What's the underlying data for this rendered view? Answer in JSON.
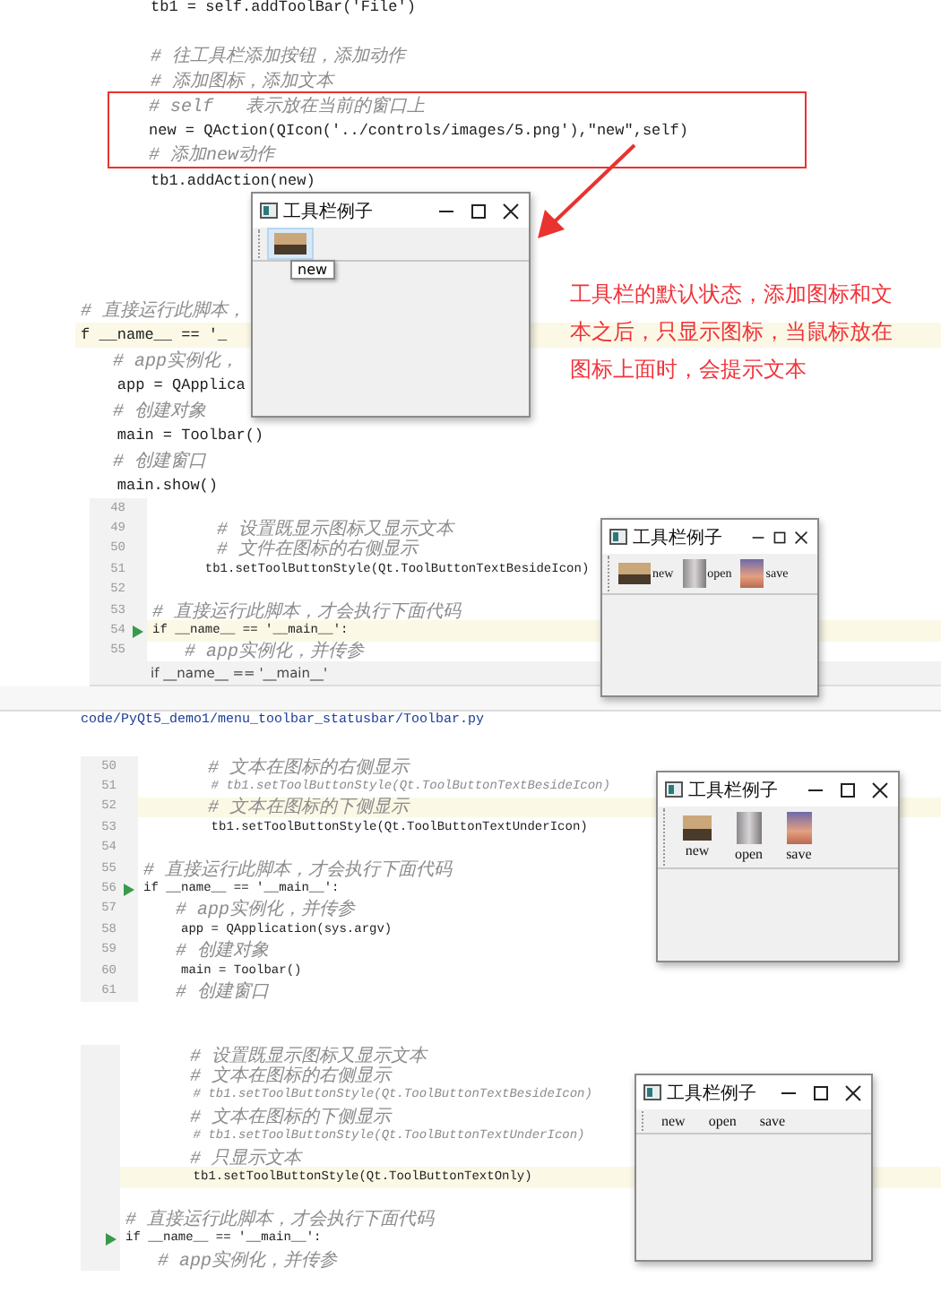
{
  "sections": [
    {
      "code_lines": [
        {
          "kind": "code",
          "text": "tb1 = self.addToolBar('File')",
          "boxed": false,
          "highlighted": false
        },
        {
          "kind": "blank",
          "boxed": false,
          "highlighted": false
        },
        {
          "kind": "comment",
          "text": "# 往工具栏添加按钮，添加动作",
          "boxed": false,
          "highlighted": false
        },
        {
          "kind": "comment",
          "text": "# 添加图标，添加文本",
          "boxed": false,
          "highlighted": false
        },
        {
          "kind": "comment",
          "text": "# self   表示放在当前的窗口上",
          "boxed": true,
          "highlighted": false
        },
        {
          "kind": "code",
          "text": "new = QAction(QIcon('../controls/images/5.png'),\"new\",self)",
          "boxed": true,
          "highlighted": false
        },
        {
          "kind": "comment",
          "text": "# 添加new动作",
          "boxed": true,
          "highlighted": false
        },
        {
          "kind": "code",
          "text": "tb1.addAction(new)",
          "boxed": false,
          "highlighted": false
        }
      ],
      "background_lines": [
        {
          "kind": "comment",
          "text": "# 直接运行此脚本，",
          "highlighted": false
        },
        {
          "kind": "code",
          "text": "f __name__ == '_",
          "highlighted": true
        },
        {
          "kind": "comment",
          "text": "   # app实例化，",
          "highlighted": false
        },
        {
          "kind": "code",
          "text": "    app = QApplica",
          "highlighted": false
        },
        {
          "kind": "comment",
          "text": "   # 创建对象",
          "highlighted": false
        },
        {
          "kind": "code",
          "text": "    main = Toolbar()",
          "highlighted": false
        },
        {
          "kind": "comment",
          "text": "   # 创建窗口",
          "highlighted": false
        },
        {
          "kind": "code",
          "text": "    main.show()",
          "highlighted": false
        }
      ],
      "window": {
        "title": "工具栏例子",
        "kind": "icon_only",
        "tooltip": "new",
        "actions": [
          {
            "hovered": true
          }
        ]
      },
      "annotation": "工具栏的默认状态，添加图标和文本之后，只显示图标，当鼠标放在图标上面时，会提示文本"
    },
    {
      "code_lines": [
        {
          "no": "48",
          "kind": "blank",
          "highlighted": false,
          "run": false
        },
        {
          "no": "49",
          "kind": "comment",
          "text": "      # 设置既显示图标又显示文本",
          "highlighted": false,
          "run": false
        },
        {
          "no": "50",
          "kind": "comment",
          "text": "      # 文件在图标的右侧显示",
          "highlighted": false,
          "run": false
        },
        {
          "no": "51",
          "kind": "code",
          "text": "       tb1.setToolButtonStyle(Qt.ToolButtonTextBesideIcon)",
          "highlighted": false,
          "run": false
        },
        {
          "no": "52",
          "kind": "blank",
          "highlighted": false,
          "run": false
        },
        {
          "no": "53",
          "kind": "comment",
          "text": "# 直接运行此脚本，才会执行下面代码",
          "highlighted": false,
          "run": false
        },
        {
          "no": "54",
          "kind": "code",
          "text": "if __name__ == '__main__':",
          "highlighted": true,
          "run": true
        },
        {
          "no": "55",
          "kind": "comment",
          "text": "   # app实例化，并传参",
          "highlighted": false,
          "run": false
        }
      ],
      "breadcrumb": "if __name__ == '__main__'",
      "file_path": "code/PyQt5_demo1/menu_toolbar_statusbar/Toolbar.py",
      "window": {
        "title": "工具栏例子",
        "kind": "text_beside_icon",
        "actions": [
          {
            "label": "new",
            "hovered": false
          },
          {
            "label": "open",
            "hovered": false
          },
          {
            "label": "save",
            "hovered": false
          }
        ]
      }
    },
    {
      "code_lines": [
        {
          "no": "50",
          "kind": "comment",
          "text": "      # 文本在图标的右侧显示",
          "highlighted": false,
          "run": false
        },
        {
          "no": "51",
          "kind": "comment",
          "text": "         # tb1.setToolButtonStyle(Qt.ToolButtonTextBesideIcon)",
          "highlighted": false,
          "run": false
        },
        {
          "no": "52",
          "kind": "comment",
          "text": "      # 文本在图标的下侧显示",
          "highlighted": true,
          "run": false
        },
        {
          "no": "53",
          "kind": "code",
          "text": "         tb1.setToolButtonStyle(Qt.ToolButtonTextUnderIcon)",
          "highlighted": false,
          "run": false
        },
        {
          "no": "54",
          "kind": "blank",
          "highlighted": false,
          "run": false
        },
        {
          "no": "55",
          "kind": "comment",
          "text": "# 直接运行此脚本，才会执行下面代码",
          "highlighted": false,
          "run": false
        },
        {
          "no": "56",
          "kind": "code",
          "text": "if __name__ == '__main__':",
          "highlighted": false,
          "run": true
        },
        {
          "no": "57",
          "kind": "comment",
          "text": "   # app实例化，并传参",
          "highlighted": false,
          "run": false
        },
        {
          "no": "58",
          "kind": "code",
          "text": "     app = QApplication(sys.argv)",
          "highlighted": false,
          "run": false
        },
        {
          "no": "59",
          "kind": "comment",
          "text": "   # 创建对象",
          "highlighted": false,
          "run": false
        },
        {
          "no": "60",
          "kind": "code",
          "text": "     main = Toolbar()",
          "highlighted": false,
          "run": false
        },
        {
          "no": "61",
          "kind": "comment",
          "text": "   # 创建窗口",
          "highlighted": false,
          "run": false
        }
      ],
      "window": {
        "title": "工具栏例子",
        "kind": "text_under_icon",
        "actions": [
          {
            "label": "new",
            "hovered": false
          },
          {
            "label": "open",
            "hovered": false
          },
          {
            "label": "save",
            "hovered": false
          }
        ]
      }
    },
    {
      "code_lines": [
        {
          "kind": "comment",
          "text": "      # 设置既显示图标又显示文本",
          "highlighted": false,
          "run": false
        },
        {
          "kind": "comment",
          "text": "      # 文本在图标的右侧显示",
          "highlighted": false,
          "run": false
        },
        {
          "kind": "comment",
          "text": "         # tb1.setToolButtonStyle(Qt.ToolButtonTextBesideIcon)",
          "highlighted": false,
          "run": false
        },
        {
          "kind": "comment",
          "text": "      # 文本在图标的下侧显示",
          "highlighted": false,
          "run": false
        },
        {
          "kind": "comment",
          "text": "         # tb1.setToolButtonStyle(Qt.ToolButtonTextUnderIcon)",
          "highlighted": false,
          "run": false
        },
        {
          "kind": "comment",
          "text": "      # 只显示文本",
          "highlighted": false,
          "run": false
        },
        {
          "kind": "code",
          "text": "         tb1.setToolButtonStyle(Qt.ToolButtonTextOnly)",
          "highlighted": true,
          "run": false
        },
        {
          "kind": "blank",
          "highlighted": false,
          "run": false
        },
        {
          "kind": "comment",
          "text": "# 直接运行此脚本，才会执行下面代码",
          "highlighted": false,
          "run": false
        },
        {
          "kind": "code",
          "text": "if __name__ == '__main__':",
          "highlighted": false,
          "run": true
        },
        {
          "kind": "comment",
          "text": "   # app实例化，并传参",
          "highlighted": false,
          "run": false
        }
      ],
      "window": {
        "title": "工具栏例子",
        "kind": "text_only",
        "actions": [
          {
            "label": "new",
            "hovered": false
          },
          {
            "label": "open",
            "hovered": false
          },
          {
            "label": "save",
            "hovered": false
          }
        ]
      }
    }
  ]
}
